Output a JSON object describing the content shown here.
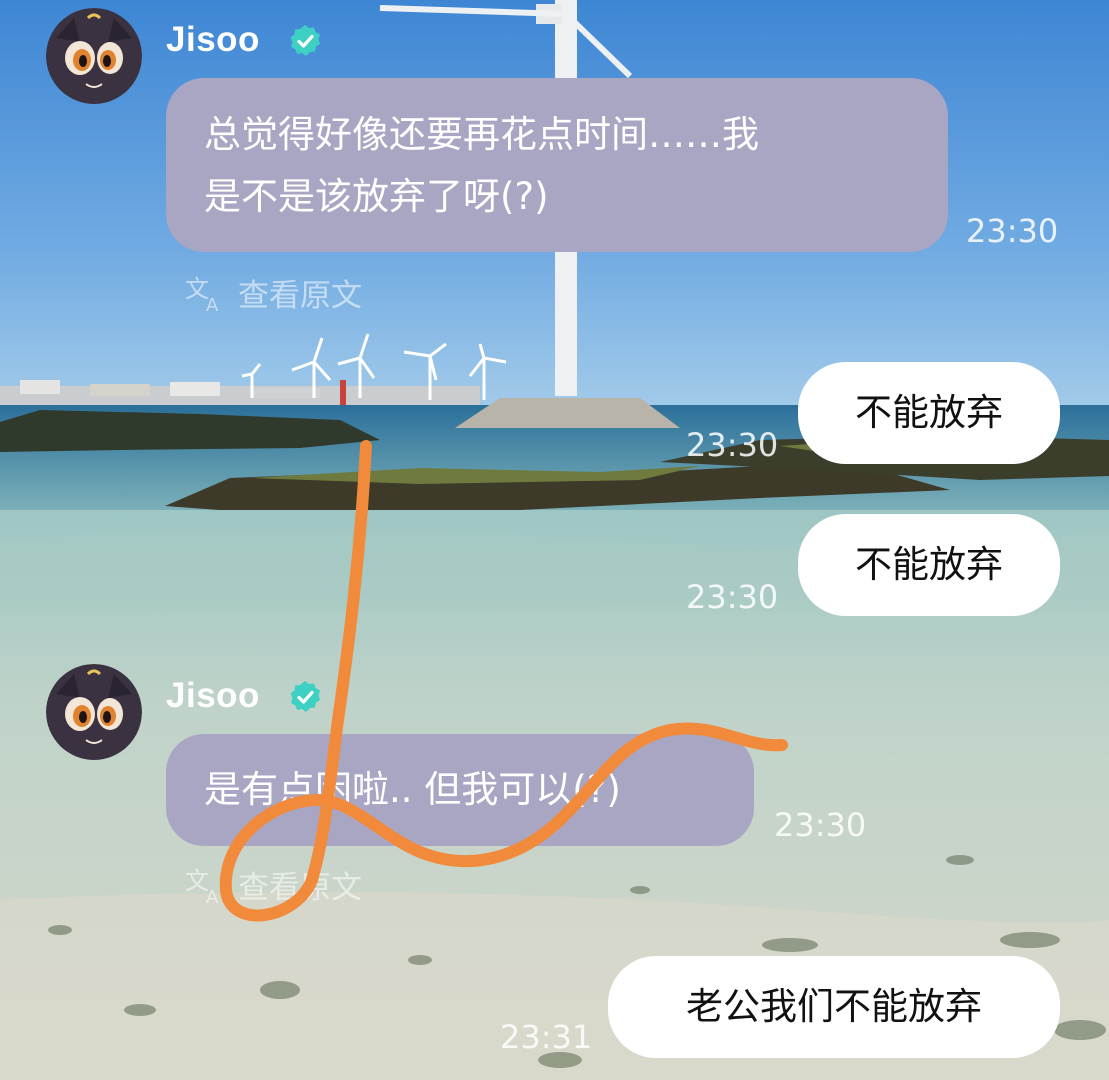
{
  "colors": {
    "incoming_bubble": "#a9a6c4",
    "outgoing_bubble": "#ffffff",
    "verified_badge": "#3fd0c4",
    "annotation_stroke": "#f28a3c"
  },
  "icons": {
    "verified": "verified-badge-icon",
    "translate": "translate-icon"
  },
  "messages": [
    {
      "direction": "incoming",
      "sender": "Jisoo",
      "lines": [
        "总觉得好像还要再花点时间……我",
        "是不是该放弃了呀(?)"
      ],
      "time": "23:30",
      "translate_label": "查看原文"
    },
    {
      "direction": "outgoing",
      "text": "不能放弃",
      "time": "23:30"
    },
    {
      "direction": "outgoing",
      "text": "不能放弃",
      "time": "23:30"
    },
    {
      "direction": "incoming",
      "sender": "Jisoo",
      "lines": [
        "是有点困啦.. 但我可以(?)"
      ],
      "time": "23:30",
      "translate_label": "查看原文"
    },
    {
      "direction": "outgoing",
      "text": "老公我们不能放弃",
      "time": "23:31"
    }
  ]
}
